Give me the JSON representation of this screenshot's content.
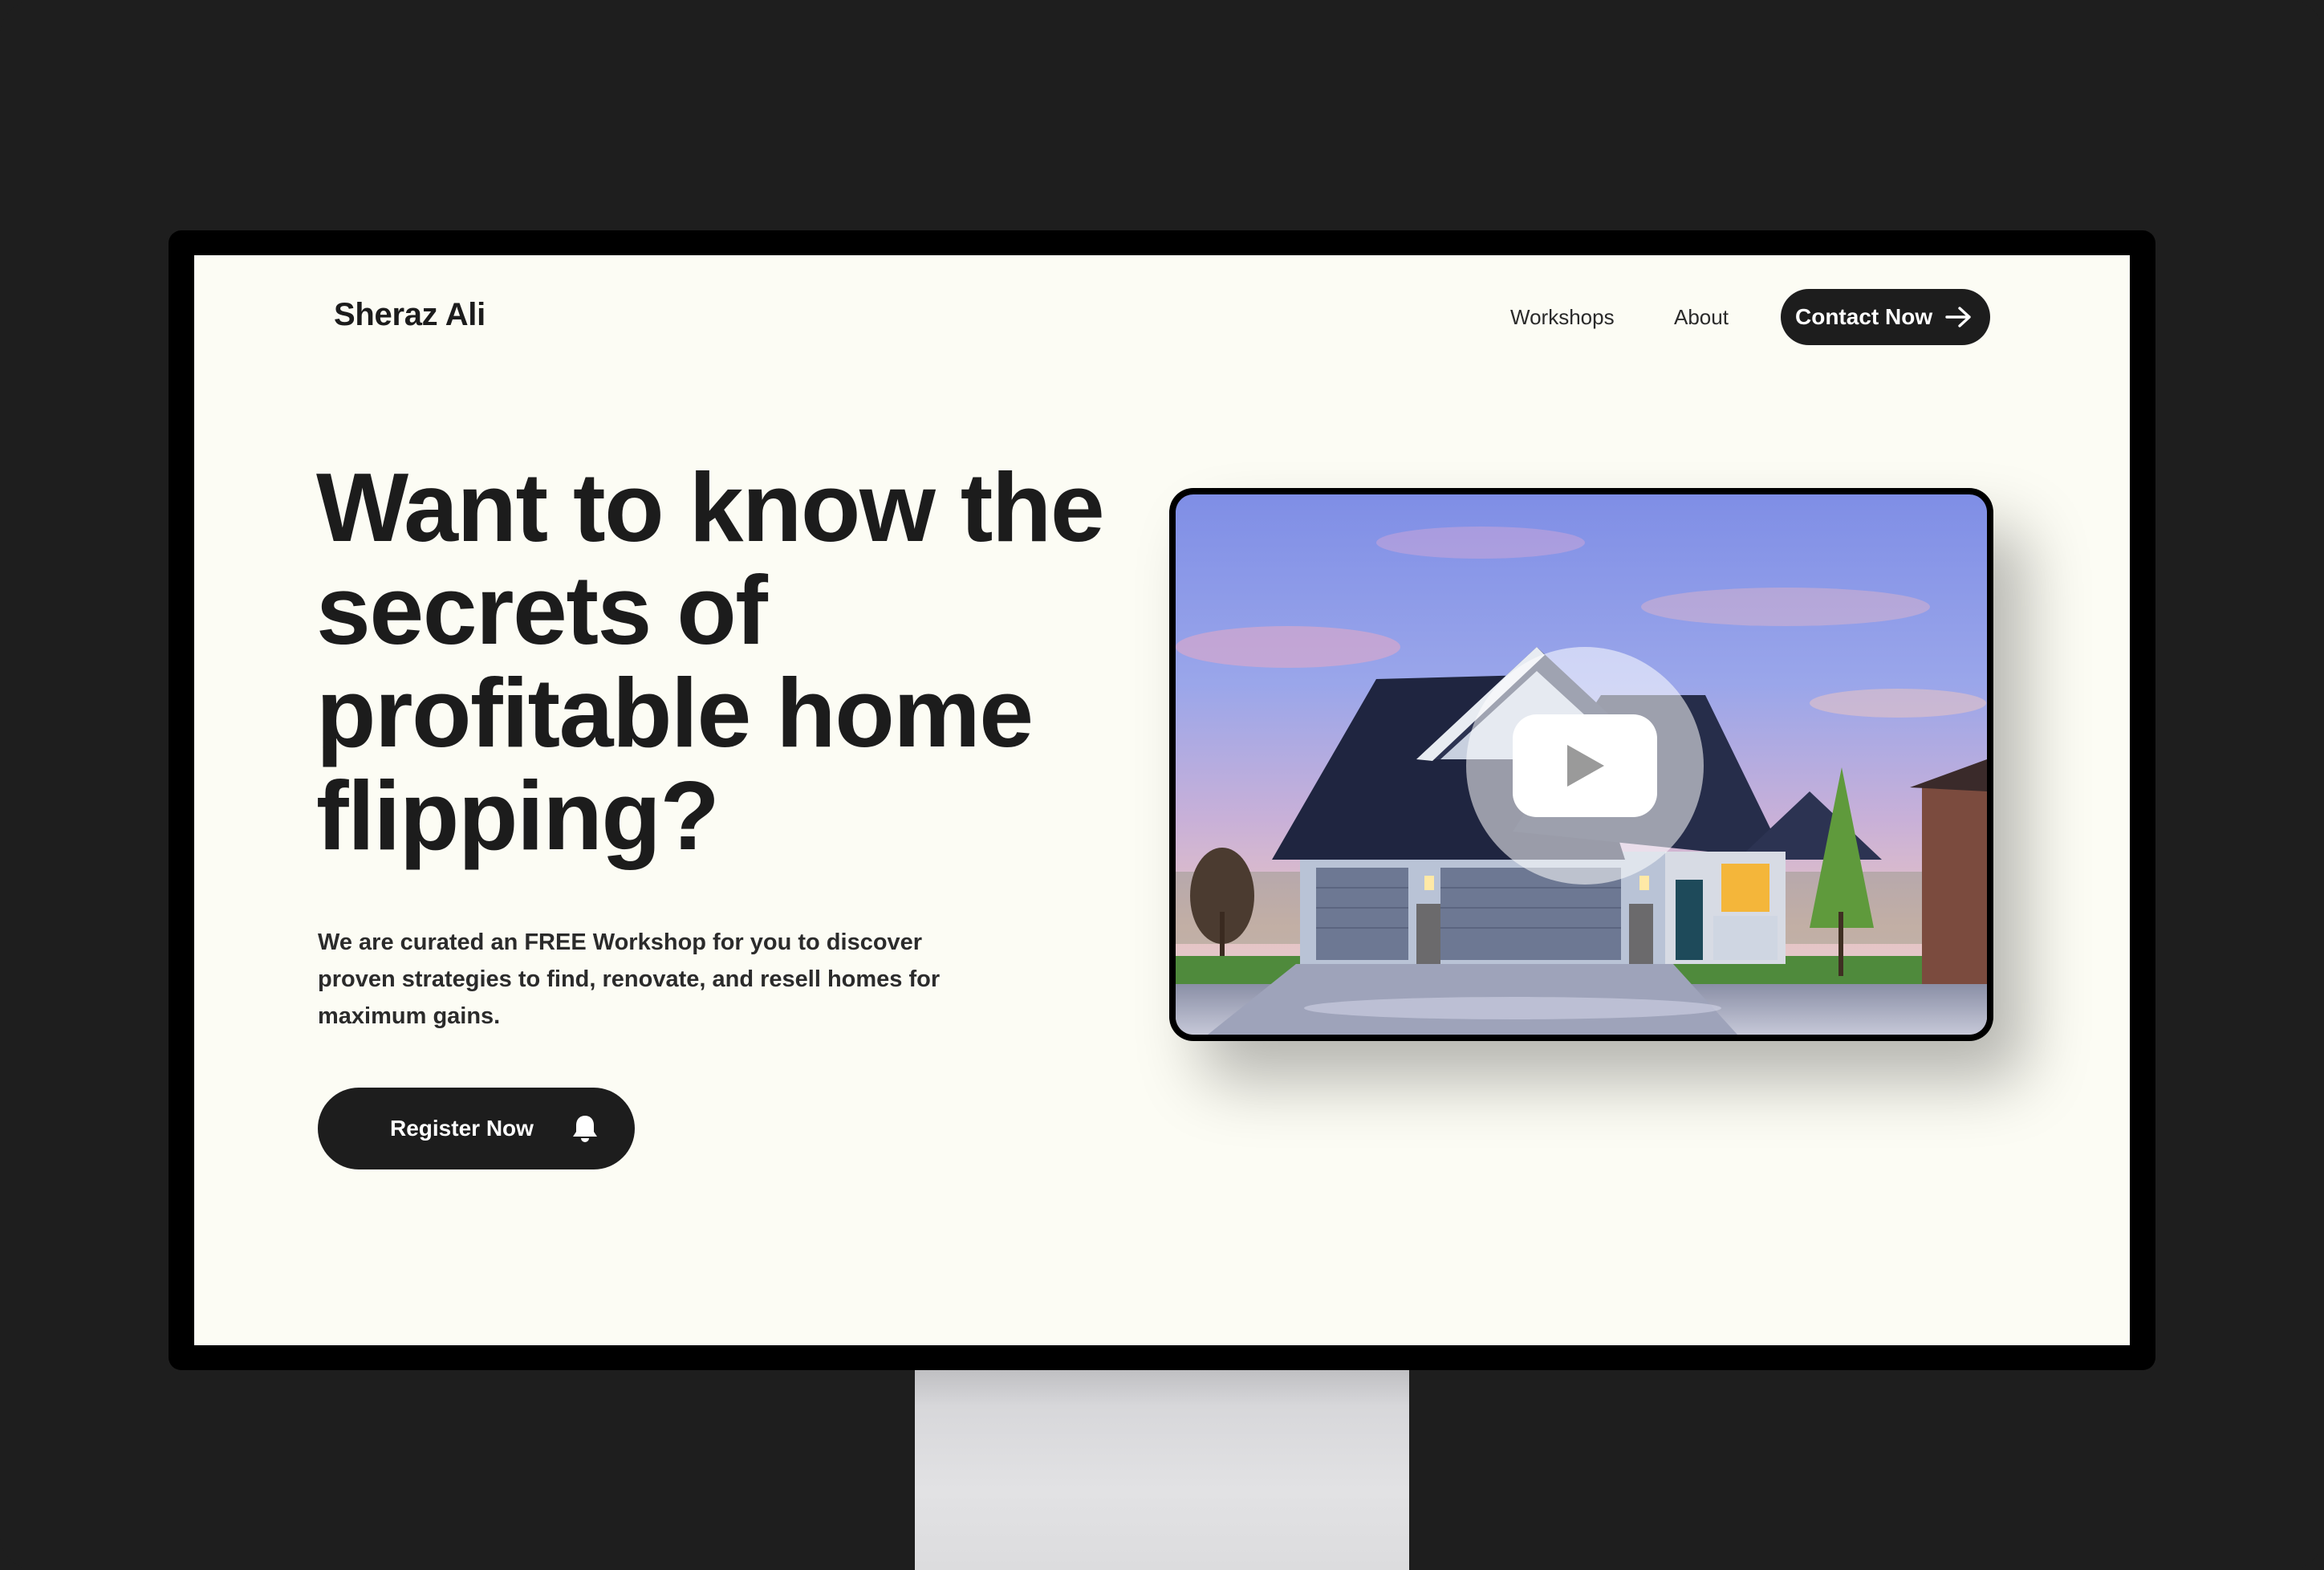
{
  "site": {
    "brand": "Sheraz Ali"
  },
  "nav": {
    "items": [
      {
        "label": "Workshops"
      },
      {
        "label": "About"
      }
    ],
    "contact_label": "Contact Now",
    "contact_icon": "arrow-right-icon"
  },
  "hero": {
    "headline": "Want to know the secrets of profitable home flipping?",
    "description": "We are curated an FREE Workshop for you to discover proven strategies to find, renovate, and resell homes for maximum gains.",
    "cta_label": "Register Now",
    "cta_icon": "bell-icon"
  },
  "video": {
    "thumbnail": "house-at-dusk-image",
    "play_icon": "play-icon"
  },
  "colors": {
    "page_background": "#fcfcf4",
    "button_dark": "#1d1d1d",
    "text_primary": "#1c1c1c",
    "frame": "#1e1e1e"
  }
}
